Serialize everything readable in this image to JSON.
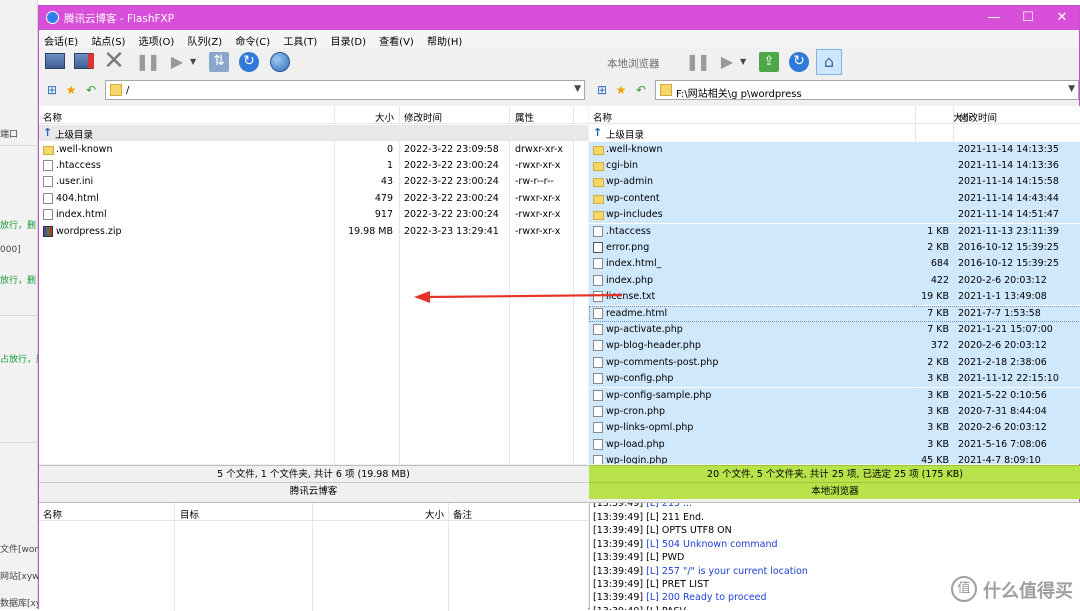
{
  "window": {
    "title": "腾讯云博客 - FlashFXP",
    "minimize": "—",
    "maximize": "☐",
    "close": "✕"
  },
  "menu": [
    "会话(E)",
    "站点(S)",
    "选项(O)",
    "队列(Z)",
    "命令(C)",
    "工具(T)",
    "目录(D)",
    "查看(V)",
    "帮助(H)"
  ],
  "left": {
    "path": "/",
    "headers": {
      "name": "名称",
      "size": "大小",
      "mtime": "修改时间",
      "attr": "属性"
    },
    "up_dir": "上级目录",
    "files": [
      {
        "name": ".well-known",
        "size": "0",
        "mtime": "2022-3-22 23:09:58",
        "attr": "drwxr-xr-x",
        "icon": "folder"
      },
      {
        "name": ".htaccess",
        "size": "1",
        "mtime": "2022-3-22 23:00:24",
        "attr": "-rwxr-xr-x",
        "icon": "file"
      },
      {
        "name": ".user.ini",
        "size": "43",
        "mtime": "2022-3-22 23:00:24",
        "attr": "-rw-r--r--",
        "icon": "file"
      },
      {
        "name": "404.html",
        "size": "479",
        "mtime": "2022-3-22 23:00:24",
        "attr": "-rwxr-xr-x",
        "icon": "file"
      },
      {
        "name": "index.html",
        "size": "917",
        "mtime": "2022-3-22 23:00:24",
        "attr": "-rwxr-xr-x",
        "icon": "file"
      },
      {
        "name": "wordpress.zip",
        "size": "19.98 MB",
        "mtime": "2022-3-23 13:29:41",
        "attr": "-rwxr-xr-x",
        "icon": "zip"
      }
    ],
    "status": "5 个文件, 1 个文件夹, 共计 6 项 (19.98 MB)",
    "site": "腾讯云博客"
  },
  "right": {
    "title": "本地浏览器",
    "path": "F:\\网站相关\\g p\\wordpress",
    "headers": {
      "name": "名称",
      "size": "大小",
      "mtime": "修改时间"
    },
    "up_dir": "上级目录",
    "files": [
      {
        "name": ".well-known",
        "size": "",
        "mtime": "2021-11-14 14:13:35",
        "icon": "folder"
      },
      {
        "name": "cgi-bin",
        "size": "",
        "mtime": "2021-11-14 14:13:36",
        "icon": "folder"
      },
      {
        "name": "wp-admin",
        "size": "",
        "mtime": "2021-11-14 14:15:58",
        "icon": "folder"
      },
      {
        "name": "wp-content",
        "size": "",
        "mtime": "2021-11-14 14:43:44",
        "icon": "folder"
      },
      {
        "name": "wp-includes",
        "size": "",
        "mtime": "2021-11-14 14:51:47",
        "icon": "folder"
      },
      {
        "name": ".htaccess",
        "size": "1 KB",
        "mtime": "2021-11-13 23:11:39",
        "icon": "file"
      },
      {
        "name": "error.png",
        "size": "2 KB",
        "mtime": "2016-10-12 15:39:25",
        "icon": "img"
      },
      {
        "name": "index.html_",
        "size": "684",
        "mtime": "2016-10-12 15:39:25",
        "icon": "file"
      },
      {
        "name": "index.php",
        "size": "422",
        "mtime": "2020-2-6 20:03:12",
        "icon": "php"
      },
      {
        "name": "license.txt",
        "size": "19 KB",
        "mtime": "2021-1-1 13:49:08",
        "icon": "file"
      },
      {
        "name": "readme.html",
        "size": "7 KB",
        "mtime": "2021-7-7 1:53:58",
        "icon": "file"
      },
      {
        "name": "wp-activate.php",
        "size": "7 KB",
        "mtime": "2021-1-21 15:07:00",
        "icon": "php"
      },
      {
        "name": "wp-blog-header.php",
        "size": "372",
        "mtime": "2020-2-6 20:03:12",
        "icon": "php"
      },
      {
        "name": "wp-comments-post.php",
        "size": "2 KB",
        "mtime": "2021-2-18 2:38:06",
        "icon": "php"
      },
      {
        "name": "wp-config.php",
        "size": "3 KB",
        "mtime": "2021-11-12 22:15:10",
        "icon": "php"
      },
      {
        "name": "wp-config-sample.php",
        "size": "3 KB",
        "mtime": "2021-5-22 0:10:56",
        "icon": "php"
      },
      {
        "name": "wp-cron.php",
        "size": "3 KB",
        "mtime": "2020-7-31 8:44:04",
        "icon": "php"
      },
      {
        "name": "wp-links-opml.php",
        "size": "3 KB",
        "mtime": "2020-2-6 20:03:12",
        "icon": "php"
      },
      {
        "name": "wp-load.php",
        "size": "3 KB",
        "mtime": "2021-5-16 7:08:06",
        "icon": "php"
      },
      {
        "name": "wp-login.php",
        "size": "45 KB",
        "mtime": "2021-4-7 8:09:10",
        "icon": "php"
      }
    ],
    "status": "20 个文件, 5 个文件夹, 共计 25 项, 已选定 25 项 (175 KB)",
    "site": "本地浏览器"
  },
  "queue": {
    "headers": {
      "name": "名称",
      "target": "目标",
      "size": "大小",
      "note": "备注"
    }
  },
  "log": [
    {
      "ts": "[13:39:49]",
      "msg": "[L] 211 End.",
      "blue": false
    },
    {
      "ts": "[13:39:49]",
      "msg": "[L] OPTS UTF8 ON",
      "blue": false
    },
    {
      "ts": "[13:39:49]",
      "msg": "[L] 504 Unknown command",
      "blue": true
    },
    {
      "ts": "[13:39:49]",
      "msg": "[L] PWD",
      "blue": false
    },
    {
      "ts": "[13:39:49]",
      "msg": "[L] 257 \"/\" is your current location",
      "blue": true
    },
    {
      "ts": "[13:39:49]",
      "msg": "[L] PRET LIST",
      "blue": false
    },
    {
      "ts": "[13:39:49]",
      "msg": "[L] 200 Ready to proceed",
      "blue": true
    },
    {
      "ts": "[13:39:49]",
      "msg": "[L] PASV",
      "blue": false
    }
  ],
  "background": {
    "lines": [
      "端口",
      "放行，删",
      "000]",
      "放行，删",
      "占放行，删",
      "文件[word",
      "网站[xywr",
      "数据库[xy"
    ]
  },
  "watermark": "值 什么值得买",
  "colors": {
    "titlebar": "#d84fd9",
    "selection": "#cfe8fc",
    "status_active": "#b7e24a",
    "arrow": "#e5332a"
  }
}
